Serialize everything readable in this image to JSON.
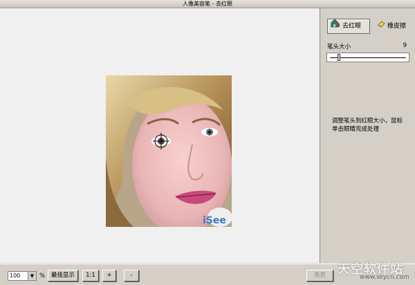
{
  "window": {
    "title": "人像美容笔 - 去红眼"
  },
  "panel": {
    "tool_redeye": {
      "label": "去红眼",
      "icon": "house-brush-icon"
    },
    "tool_eraser": {
      "label": "橡皮擦",
      "icon": "eraser-icon"
    },
    "brush_size_label": "笔头大小",
    "brush_size_value": "9",
    "brush_size_fraction": 0.1,
    "hint_line1": "调整笔头到红眼大小，鼠标",
    "hint_line2": "单击眼睛完成处理"
  },
  "bottom": {
    "zoom_value": "100",
    "zoom_unit": "%",
    "best_fit_label": "最佳显示",
    "actual_size_label": "1:1",
    "zoom_in_label": "+",
    "zoom_out_label": "-",
    "reset_label": "重置"
  },
  "watermark": {
    "text": "天空软件站",
    "url": "www.skycn.com"
  },
  "colors": {
    "accent_redeye": "#c03030",
    "eraser_yellow": "#e8d84a"
  }
}
